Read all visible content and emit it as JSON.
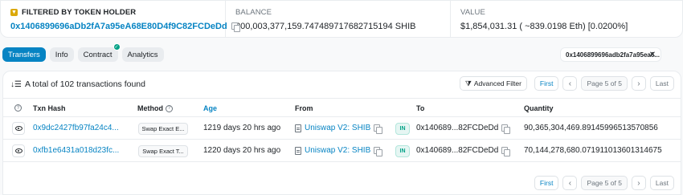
{
  "summary_card": {
    "filter": {
      "label": "FILTERED BY TOKEN HOLDER",
      "address": "0x1406899696aDb2fA7a95eA68E80D4f9C82FCDeDd"
    },
    "balance": {
      "label": "BALANCE",
      "value": "200,003,377,159.747489717682715194 SHIB"
    },
    "value": {
      "label": "VALUE",
      "value": "$1,854,031.31 ( ~839.0198 Eth) [0.0200%]"
    }
  },
  "tabs": [
    {
      "label": "Transfers",
      "active": true
    },
    {
      "label": "Info",
      "active": false
    },
    {
      "label": "Contract",
      "active": false,
      "verified": true
    },
    {
      "label": "Analytics",
      "active": false
    }
  ],
  "filter_chip": {
    "text": "0x1406899696adb2fa7a95ea6...",
    "close": "✕"
  },
  "table": {
    "summary_text": "A total of 102 transactions found",
    "advanced_filter": "Advanced Filter",
    "pager": {
      "first": "First",
      "prev": "‹",
      "page_info": "Page 5 of 5",
      "next": "›",
      "last": "Last"
    },
    "columns": {
      "txn_hash": "Txn Hash",
      "method": "Method",
      "age": "Age",
      "from": "From",
      "to": "To",
      "quantity": "Quantity"
    },
    "rows": [
      {
        "txn_hash": "0x9dc2427fb97fa24c4...",
        "method": "Swap Exact E...",
        "age": "1219 days 20 hrs ago",
        "from": "Uniswap V2: SHIB",
        "direction": "IN",
        "to": "0x140689...82FCDeDd",
        "quantity": "90,365,304,469.89145996513570856"
      },
      {
        "txn_hash": "0xfb1e6431a018d23fc...",
        "method": "Swap Exact T...",
        "age": "1220 days 20 hrs ago",
        "from": "Uniswap V2: SHIB",
        "direction": "IN",
        "to": "0x140689...82FCDeDd",
        "quantity": "70,144,278,680.071911013601314675"
      }
    ]
  },
  "colors": {
    "accent": "#0784c3",
    "success": "#00a186",
    "token": "#dba90a"
  }
}
